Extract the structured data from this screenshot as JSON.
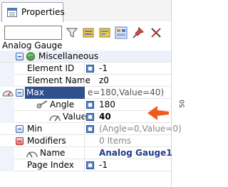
{
  "panel": {
    "tab_label": "Properties"
  },
  "toolbar": {
    "search_value": ""
  },
  "object_title": "Analog Gauge",
  "side_ruler_label": "50",
  "properties": {
    "category_misc": "Miscellaneous",
    "element_id": {
      "name": "Element ID",
      "value": "-1"
    },
    "element_name": {
      "name": "Element Name",
      "value": "z0"
    },
    "max": {
      "name": "Max",
      "value": "e=180,Value=40)"
    },
    "angle": {
      "name": "Angle",
      "value": "180"
    },
    "value": {
      "name": "Value",
      "value": "40"
    },
    "min": {
      "name": "Min",
      "value": "(Angle=0,Value=0)"
    },
    "modifiers": {
      "name": "Modifiers",
      "value": "0 Items"
    },
    "obj_name": {
      "name": "Name",
      "value": "Analog Gauge1"
    },
    "page_index": {
      "name": "Page Index",
      "value": "-1"
    }
  },
  "colors": {
    "selection": "#2f4f8f",
    "arrow": "#f05a1a",
    "accent": "#1f3d8a"
  }
}
